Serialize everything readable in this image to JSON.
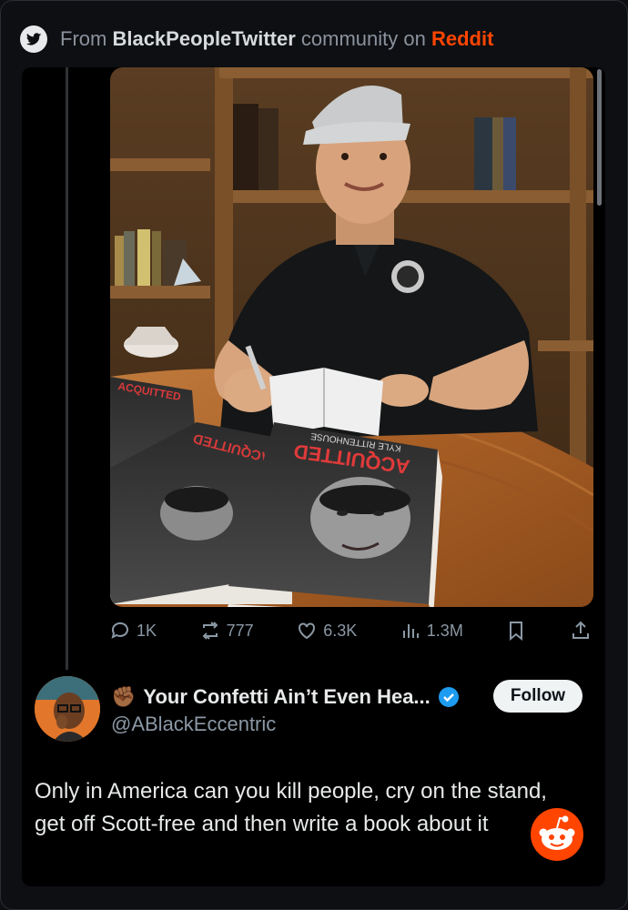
{
  "header": {
    "prefix": "From",
    "community": "BlackPeopleTwitter",
    "middle": "community on",
    "platform": "Reddit"
  },
  "actions": {
    "replies": "1K",
    "retweets": "777",
    "likes": "6.3K",
    "views": "1.3M"
  },
  "reply": {
    "emoji": "✊🏾",
    "display_name": "Your Confetti Ain’t Even Hea...",
    "handle": "@ABlackEccentric",
    "follow_label": "Follow",
    "text": "Only in America can you kill people, cry on the stand, get off Scott-free and then write a book about it"
  },
  "book": {
    "title": "ACQUITTED",
    "author": "KYLE RITTENHOUSE"
  },
  "colors": {
    "reddit_orange": "#ff4500",
    "verified_blue": "#1d9bf0",
    "background": "#000000"
  }
}
